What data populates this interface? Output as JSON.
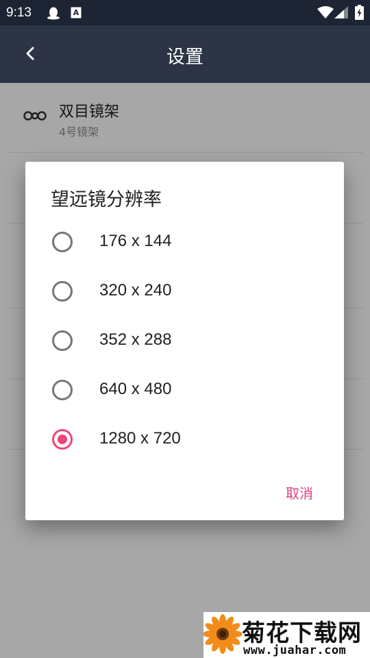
{
  "status_bar": {
    "time": "9:13",
    "icons": [
      "qq-penguin-icon",
      "keyboard-a-icon",
      "wifi-icon",
      "signal-icon",
      "battery-charging-icon"
    ]
  },
  "app_bar": {
    "back_icon": "chevron-left-icon",
    "title": "设置"
  },
  "settings": {
    "items": [
      {
        "icon": "binoculars-icon",
        "title": "双目镜架",
        "subtitle": "4号镜架"
      }
    ]
  },
  "dialog": {
    "title": "望远镜分辨率",
    "options": [
      {
        "label": "176 x 144",
        "selected": false
      },
      {
        "label": "320 x 240",
        "selected": false
      },
      {
        "label": "352 x 288",
        "selected": false
      },
      {
        "label": "640 x 480",
        "selected": false
      },
      {
        "label": "1280 x 720",
        "selected": true
      }
    ],
    "cancel_label": "取消"
  },
  "watermark": {
    "title": "菊花下载网",
    "url": "www.juahar.com"
  },
  "colors": {
    "status_bar_bg": "#1d2433",
    "app_bar_bg": "#2d3445",
    "accent": "#f04478",
    "cancel_text": "#e83e82"
  }
}
